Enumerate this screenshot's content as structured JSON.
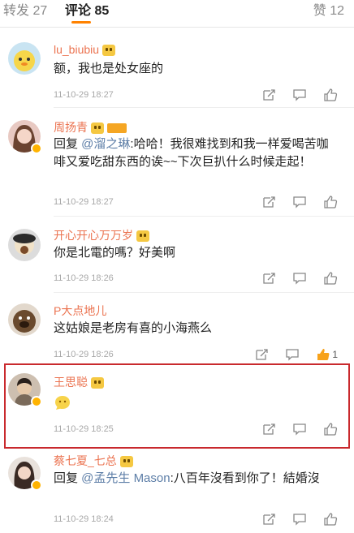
{
  "tabs": {
    "repost": "转发 27",
    "comments": "评论 85",
    "likes": "赞 12"
  },
  "colors": {
    "accent": "#ff8200",
    "username": "#eb7350",
    "mention": "#5d7ea7",
    "highlight": "#c9292d"
  },
  "comments": [
    {
      "user": "lu_biubiu",
      "text": "额，我也是处女座的",
      "time": "11-10-29 18:27",
      "likes": ""
    },
    {
      "user": "周扬青",
      "reply_prefix": "回复 ",
      "mention": "@溜之琳",
      "text": ":哈哈！我很难找到和我一样爱喝苦咖啡又爱吃甜东西的诶~~下次巨扒什么时候走起！",
      "time": "11-10-29 18:27",
      "likes": ""
    },
    {
      "user": "开心开心万万岁",
      "text": "你是北電的嗎？好美啊",
      "time": "11-10-29 18:26",
      "likes": ""
    },
    {
      "user": "P大点地儿",
      "text": "这姑娘是老房有喜的小海燕么",
      "time": "11-10-29 18:26",
      "likes": "1"
    },
    {
      "user": "王思聪",
      "text": "",
      "time": "11-10-29 18:25",
      "likes": ""
    },
    {
      "user": "蔡七夏_七总",
      "reply_prefix": "回复 ",
      "mention": "@孟先生 Mason",
      "text": ":八百年沒看到你了！結婚沒",
      "time": "11-10-29 18:24",
      "likes": ""
    }
  ],
  "icons": [
    "repost-icon",
    "comment-icon",
    "like-icon",
    "emoji-badge-icon",
    "verified-badge-icon"
  ]
}
